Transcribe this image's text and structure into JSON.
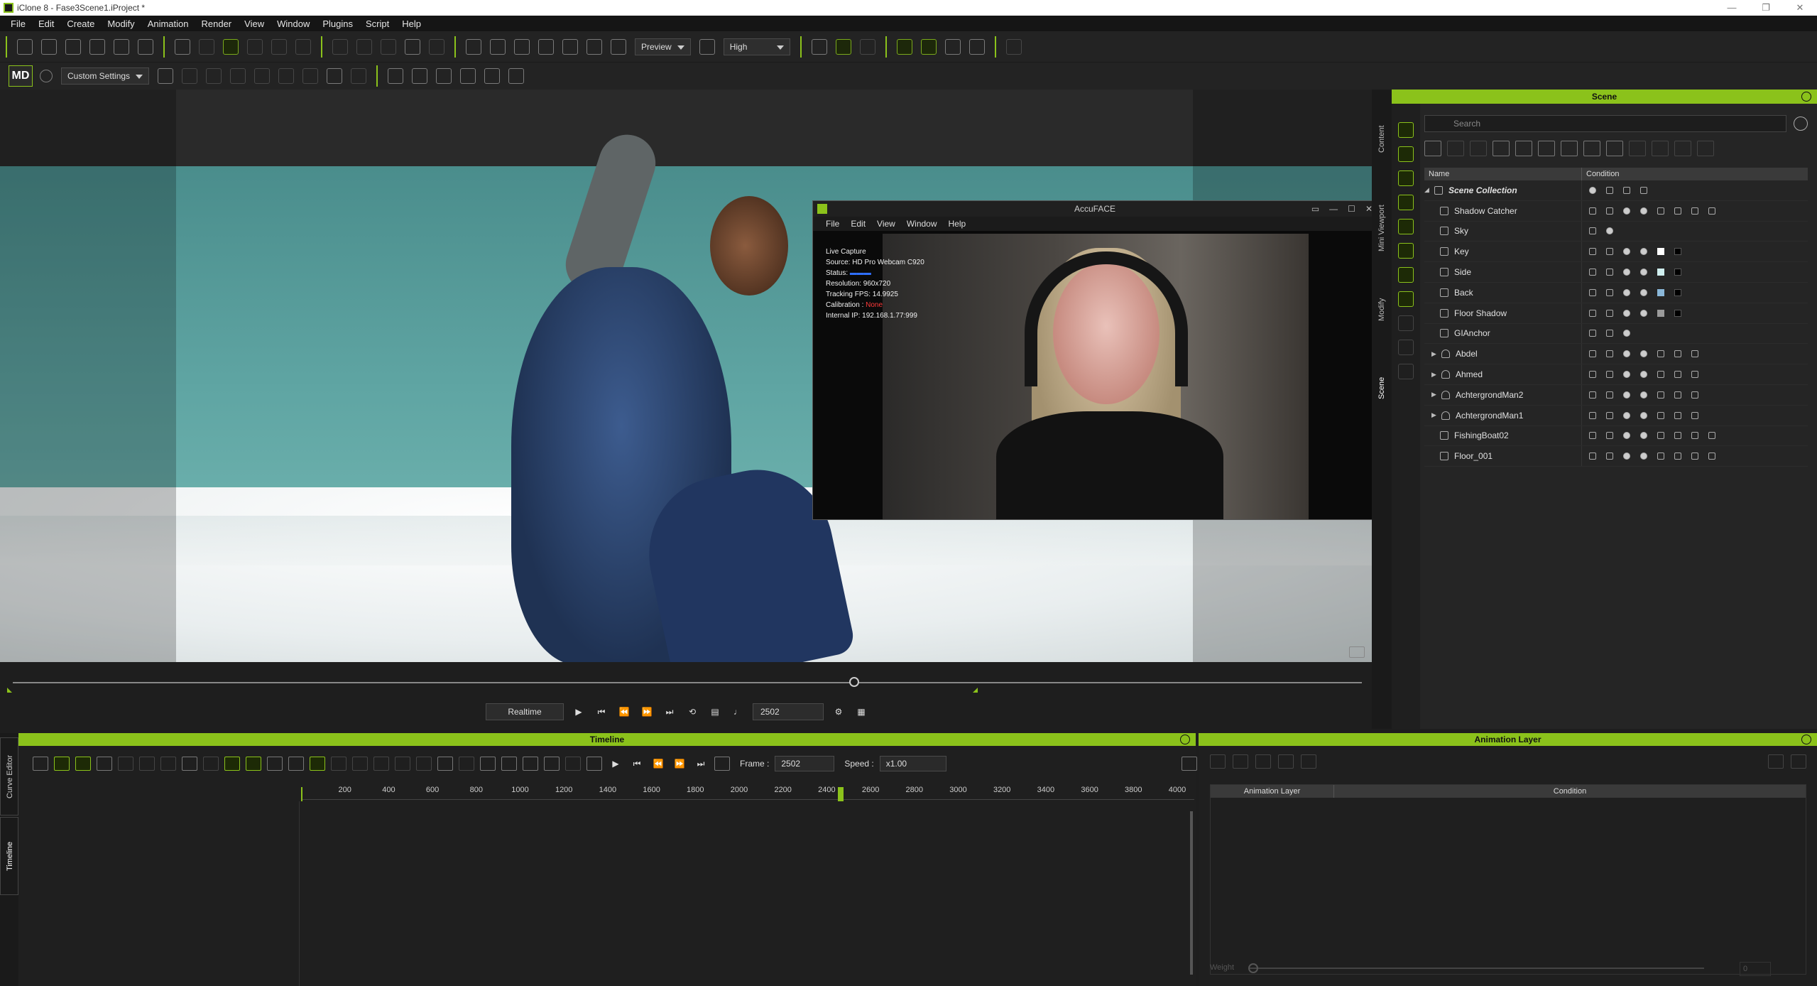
{
  "window": {
    "title": "iClone 8 - Fase3Scene1.iProject *",
    "controls": [
      "—",
      "❐",
      "✕"
    ]
  },
  "menu": [
    "File",
    "Edit",
    "Create",
    "Modify",
    "Animation",
    "Render",
    "View",
    "Window",
    "Plugins",
    "Script",
    "Help"
  ],
  "toolbar": {
    "preview_mode": "Preview",
    "quality": "High",
    "custom_settings": "Custom Settings",
    "md_logo": "MD"
  },
  "accuface": {
    "title": "AccuFACE",
    "menu": [
      "File",
      "Edit",
      "View",
      "Window",
      "Help"
    ],
    "info": {
      "line1": "Live Capture",
      "source": "Source: HD Pro Webcam C920",
      "status_label": "Status:",
      "resolution": "Resolution: 960x720",
      "fps": "Tracking FPS: 14.9925",
      "calibration_label": "Calibration :",
      "calibration_value": "None",
      "ip": "Internal IP: 192.168.1.77:999"
    }
  },
  "playback": {
    "mode": "Realtime",
    "frame": "2502"
  },
  "right_tabs": [
    "Content",
    "Mini Viewport",
    "Modify",
    "Scene"
  ],
  "scene": {
    "title": "Scene",
    "search_placeholder": "Search",
    "col_name": "Name",
    "col_condition": "Condition",
    "rows": [
      {
        "label": "Scene Collection"
      },
      {
        "label": "Shadow Catcher"
      },
      {
        "label": "Sky"
      },
      {
        "label": "Key",
        "swatch": "#ffffff"
      },
      {
        "label": "Side",
        "swatch": "#cfeeee"
      },
      {
        "label": "Back",
        "swatch": "#8ab7d8"
      },
      {
        "label": "Floor Shadow",
        "swatch": "#9a9a9a"
      },
      {
        "label": "GIAnchor"
      },
      {
        "label": "Abdel"
      },
      {
        "label": "Ahmed"
      },
      {
        "label": "AchtergrondMan2"
      },
      {
        "label": "AchtergrondMan1"
      },
      {
        "label": "FishingBoat02"
      },
      {
        "label": "Floor_001"
      }
    ]
  },
  "timeline": {
    "title": "Timeline",
    "frame_label": "Frame :",
    "frame_value": "2502",
    "speed_label": "Speed :",
    "speed_value": "x1.00",
    "ticks": [
      "200",
      "400",
      "600",
      "800",
      "1000",
      "1200",
      "1400",
      "1600",
      "1800",
      "2000",
      "2200",
      "2400",
      "2600",
      "2800",
      "3000",
      "3200",
      "3400",
      "3600",
      "3800",
      "4000"
    ],
    "left_tabs": [
      "Curve Editor",
      "Timeline"
    ]
  },
  "animation_layer": {
    "title": "Animation Layer",
    "col_layer": "Animation Layer",
    "col_condition": "Condition",
    "weight_label": "Weight",
    "weight_value": "0"
  }
}
